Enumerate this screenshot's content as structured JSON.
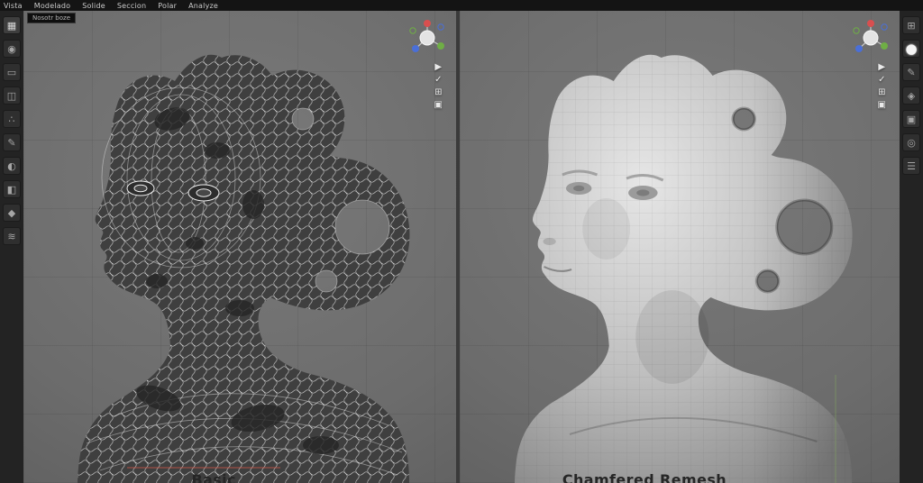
{
  "header": {
    "menu_items": [
      "Vista",
      "Modelado",
      "Solide",
      "Seccion",
      "Polar",
      "Analyze"
    ],
    "tool_box_label": "Nosotr boze"
  },
  "left_toolbar": {
    "tools": [
      {
        "name": "select",
        "glyph": "▦"
      },
      {
        "name": "transform",
        "glyph": "◉"
      },
      {
        "name": "clay",
        "glyph": "▭"
      },
      {
        "name": "clay-strips",
        "glyph": "◫"
      },
      {
        "name": "dots",
        "glyph": "∴"
      },
      {
        "name": "draw",
        "glyph": "✎"
      },
      {
        "name": "sphere",
        "glyph": "◐"
      },
      {
        "name": "flatten",
        "glyph": "◧"
      },
      {
        "name": "crease",
        "glyph": "◆"
      },
      {
        "name": "smooth",
        "glyph": "≋"
      }
    ]
  },
  "right_toolbar": {
    "tools": [
      {
        "name": "maximize",
        "glyph": "⊞"
      },
      {
        "name": "matcap-sphere",
        "glyph": "●"
      },
      {
        "name": "draw",
        "glyph": "✎"
      },
      {
        "name": "snap",
        "glyph": "◈"
      },
      {
        "name": "cube",
        "glyph": "▣"
      },
      {
        "name": "target",
        "glyph": "◎"
      },
      {
        "name": "menu",
        "glyph": "☰"
      }
    ]
  },
  "overlay": {
    "icons": [
      {
        "name": "cursor",
        "glyph": "▶"
      },
      {
        "name": "confirm",
        "glyph": "✓"
      },
      {
        "name": "zoom",
        "glyph": "⊞"
      },
      {
        "name": "camera",
        "glyph": "▣"
      }
    ]
  },
  "viewports": {
    "left": {
      "caption": "Basic"
    },
    "right": {
      "caption": "Chamfered Remesh"
    }
  },
  "colors": {
    "axis_x": "#d94f4f",
    "axis_y": "#6fae45",
    "axis_z": "#4a6fd8",
    "viewport_bg": "#6e6e6e"
  }
}
